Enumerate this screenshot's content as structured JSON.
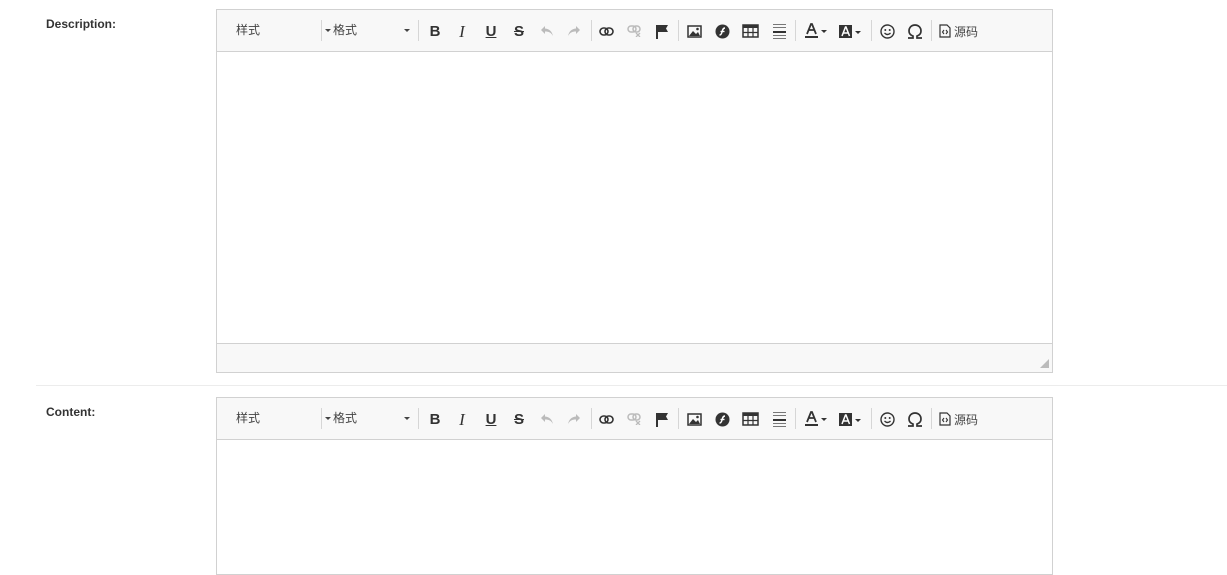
{
  "fields": [
    {
      "label": "Description:"
    },
    {
      "label": "Content:"
    }
  ],
  "toolbar": {
    "style_combo": "样式",
    "format_combo": "格式",
    "bold": "B",
    "italic": "I",
    "underline": "U",
    "strike": "S",
    "source_label": "源码"
  },
  "icons": [
    "bold-icon",
    "italic-icon",
    "underline-icon",
    "strikethrough-icon",
    "undo-icon",
    "redo-icon",
    "link-icon",
    "unlink-icon",
    "anchor-flag-icon",
    "image-icon",
    "flash-icon",
    "table-icon",
    "horizontal-rule-icon",
    "text-color-icon",
    "background-color-icon",
    "smiley-icon",
    "special-char-omega-icon",
    "source-code-icon"
  ],
  "colors": {
    "border": "#d1d1d1",
    "toolbar_bg": "#f8f8f8",
    "disabled": "#bbbbbb"
  }
}
